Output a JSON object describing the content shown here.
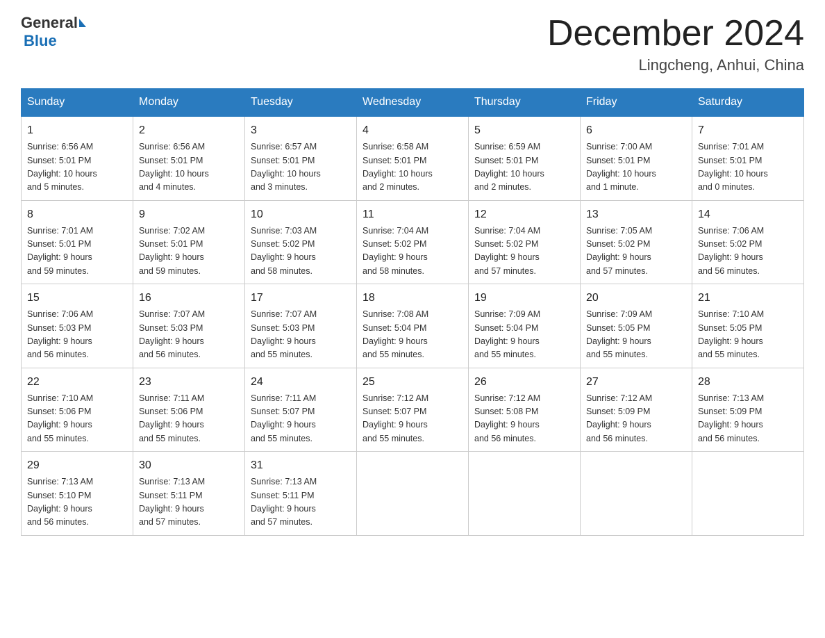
{
  "header": {
    "logo_general": "General",
    "logo_blue": "Blue",
    "month_title": "December 2024",
    "location": "Lingcheng, Anhui, China"
  },
  "days_of_week": [
    "Sunday",
    "Monday",
    "Tuesday",
    "Wednesday",
    "Thursday",
    "Friday",
    "Saturday"
  ],
  "weeks": [
    [
      {
        "day": "1",
        "info": "Sunrise: 6:56 AM\nSunset: 5:01 PM\nDaylight: 10 hours\nand 5 minutes."
      },
      {
        "day": "2",
        "info": "Sunrise: 6:56 AM\nSunset: 5:01 PM\nDaylight: 10 hours\nand 4 minutes."
      },
      {
        "day": "3",
        "info": "Sunrise: 6:57 AM\nSunset: 5:01 PM\nDaylight: 10 hours\nand 3 minutes."
      },
      {
        "day": "4",
        "info": "Sunrise: 6:58 AM\nSunset: 5:01 PM\nDaylight: 10 hours\nand 2 minutes."
      },
      {
        "day": "5",
        "info": "Sunrise: 6:59 AM\nSunset: 5:01 PM\nDaylight: 10 hours\nand 2 minutes."
      },
      {
        "day": "6",
        "info": "Sunrise: 7:00 AM\nSunset: 5:01 PM\nDaylight: 10 hours\nand 1 minute."
      },
      {
        "day": "7",
        "info": "Sunrise: 7:01 AM\nSunset: 5:01 PM\nDaylight: 10 hours\nand 0 minutes."
      }
    ],
    [
      {
        "day": "8",
        "info": "Sunrise: 7:01 AM\nSunset: 5:01 PM\nDaylight: 9 hours\nand 59 minutes."
      },
      {
        "day": "9",
        "info": "Sunrise: 7:02 AM\nSunset: 5:01 PM\nDaylight: 9 hours\nand 59 minutes."
      },
      {
        "day": "10",
        "info": "Sunrise: 7:03 AM\nSunset: 5:02 PM\nDaylight: 9 hours\nand 58 minutes."
      },
      {
        "day": "11",
        "info": "Sunrise: 7:04 AM\nSunset: 5:02 PM\nDaylight: 9 hours\nand 58 minutes."
      },
      {
        "day": "12",
        "info": "Sunrise: 7:04 AM\nSunset: 5:02 PM\nDaylight: 9 hours\nand 57 minutes."
      },
      {
        "day": "13",
        "info": "Sunrise: 7:05 AM\nSunset: 5:02 PM\nDaylight: 9 hours\nand 57 minutes."
      },
      {
        "day": "14",
        "info": "Sunrise: 7:06 AM\nSunset: 5:02 PM\nDaylight: 9 hours\nand 56 minutes."
      }
    ],
    [
      {
        "day": "15",
        "info": "Sunrise: 7:06 AM\nSunset: 5:03 PM\nDaylight: 9 hours\nand 56 minutes."
      },
      {
        "day": "16",
        "info": "Sunrise: 7:07 AM\nSunset: 5:03 PM\nDaylight: 9 hours\nand 56 minutes."
      },
      {
        "day": "17",
        "info": "Sunrise: 7:07 AM\nSunset: 5:03 PM\nDaylight: 9 hours\nand 55 minutes."
      },
      {
        "day": "18",
        "info": "Sunrise: 7:08 AM\nSunset: 5:04 PM\nDaylight: 9 hours\nand 55 minutes."
      },
      {
        "day": "19",
        "info": "Sunrise: 7:09 AM\nSunset: 5:04 PM\nDaylight: 9 hours\nand 55 minutes."
      },
      {
        "day": "20",
        "info": "Sunrise: 7:09 AM\nSunset: 5:05 PM\nDaylight: 9 hours\nand 55 minutes."
      },
      {
        "day": "21",
        "info": "Sunrise: 7:10 AM\nSunset: 5:05 PM\nDaylight: 9 hours\nand 55 minutes."
      }
    ],
    [
      {
        "day": "22",
        "info": "Sunrise: 7:10 AM\nSunset: 5:06 PM\nDaylight: 9 hours\nand 55 minutes."
      },
      {
        "day": "23",
        "info": "Sunrise: 7:11 AM\nSunset: 5:06 PM\nDaylight: 9 hours\nand 55 minutes."
      },
      {
        "day": "24",
        "info": "Sunrise: 7:11 AM\nSunset: 5:07 PM\nDaylight: 9 hours\nand 55 minutes."
      },
      {
        "day": "25",
        "info": "Sunrise: 7:12 AM\nSunset: 5:07 PM\nDaylight: 9 hours\nand 55 minutes."
      },
      {
        "day": "26",
        "info": "Sunrise: 7:12 AM\nSunset: 5:08 PM\nDaylight: 9 hours\nand 56 minutes."
      },
      {
        "day": "27",
        "info": "Sunrise: 7:12 AM\nSunset: 5:09 PM\nDaylight: 9 hours\nand 56 minutes."
      },
      {
        "day": "28",
        "info": "Sunrise: 7:13 AM\nSunset: 5:09 PM\nDaylight: 9 hours\nand 56 minutes."
      }
    ],
    [
      {
        "day": "29",
        "info": "Sunrise: 7:13 AM\nSunset: 5:10 PM\nDaylight: 9 hours\nand 56 minutes."
      },
      {
        "day": "30",
        "info": "Sunrise: 7:13 AM\nSunset: 5:11 PM\nDaylight: 9 hours\nand 57 minutes."
      },
      {
        "day": "31",
        "info": "Sunrise: 7:13 AM\nSunset: 5:11 PM\nDaylight: 9 hours\nand 57 minutes."
      },
      {
        "day": "",
        "info": ""
      },
      {
        "day": "",
        "info": ""
      },
      {
        "day": "",
        "info": ""
      },
      {
        "day": "",
        "info": ""
      }
    ]
  ]
}
